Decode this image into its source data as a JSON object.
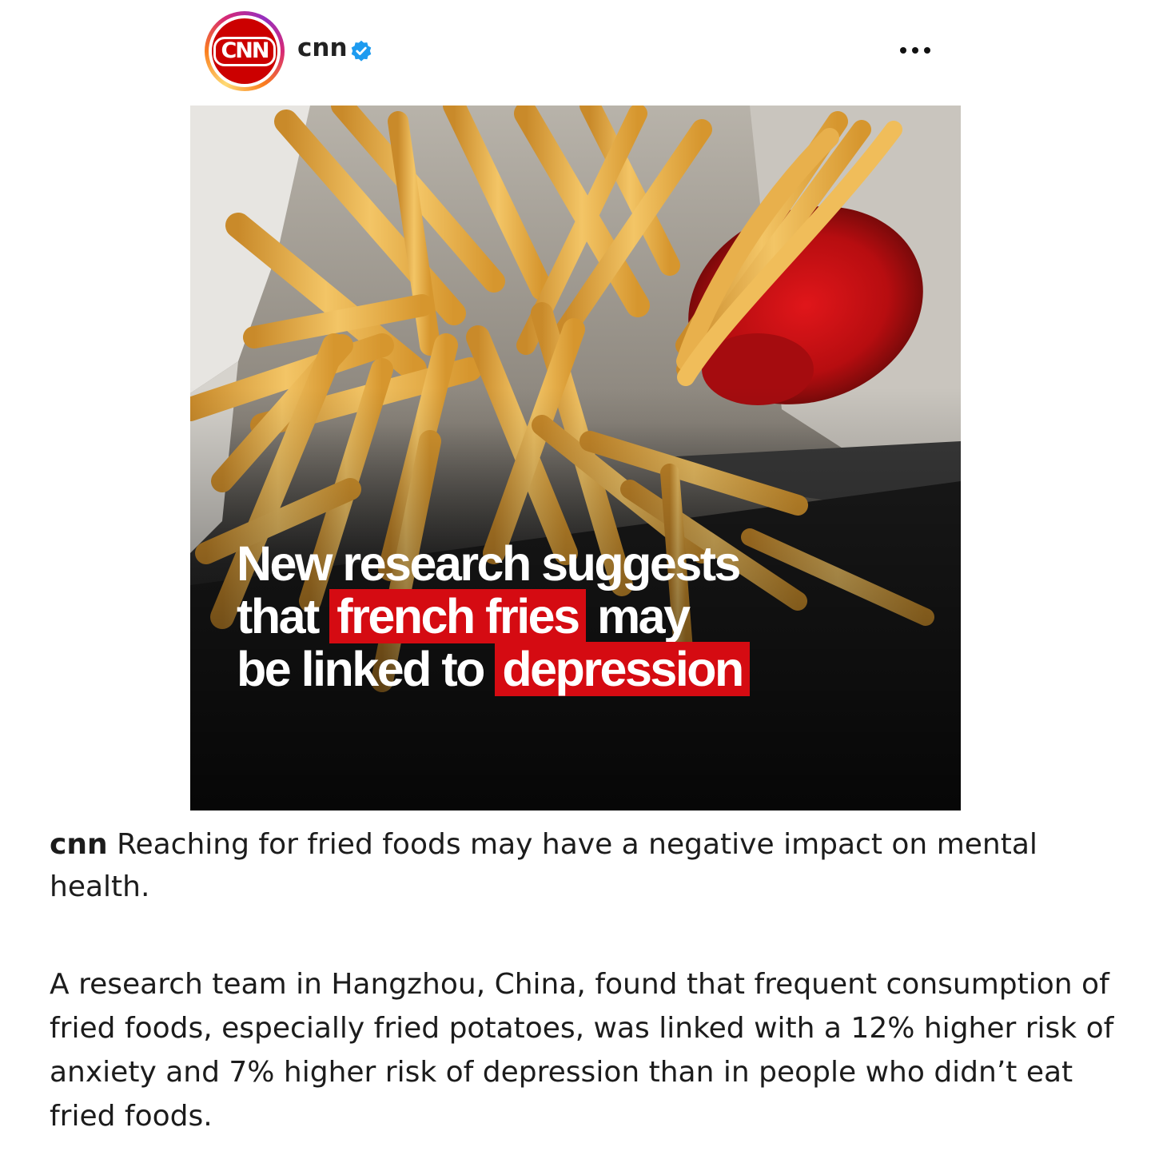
{
  "post": {
    "username": "cnn",
    "verified": true,
    "avatar": {
      "logo_text": "CNN",
      "brand_color": "#cc0000"
    },
    "more_icon": "more-options-icon",
    "image": {
      "headline": {
        "line1": "New research suggests",
        "line2_pre": "that ",
        "line2_highlight": "french fries",
        "line2_post": " may",
        "line3_pre": "be linked to ",
        "line3_highlight": "depression"
      },
      "highlight_color": "#d50b12"
    },
    "caption": {
      "username": "cnn",
      "text": "Reaching for fried foods may have a negative impact on mental health.",
      "body": "A research team in Hangzhou, China, found that frequent consumption of fried foods, especially fried potatoes, was linked with a 12% higher risk of anxiety and 7% higher risk of depression than in people who didn’t eat fried foods."
    }
  }
}
